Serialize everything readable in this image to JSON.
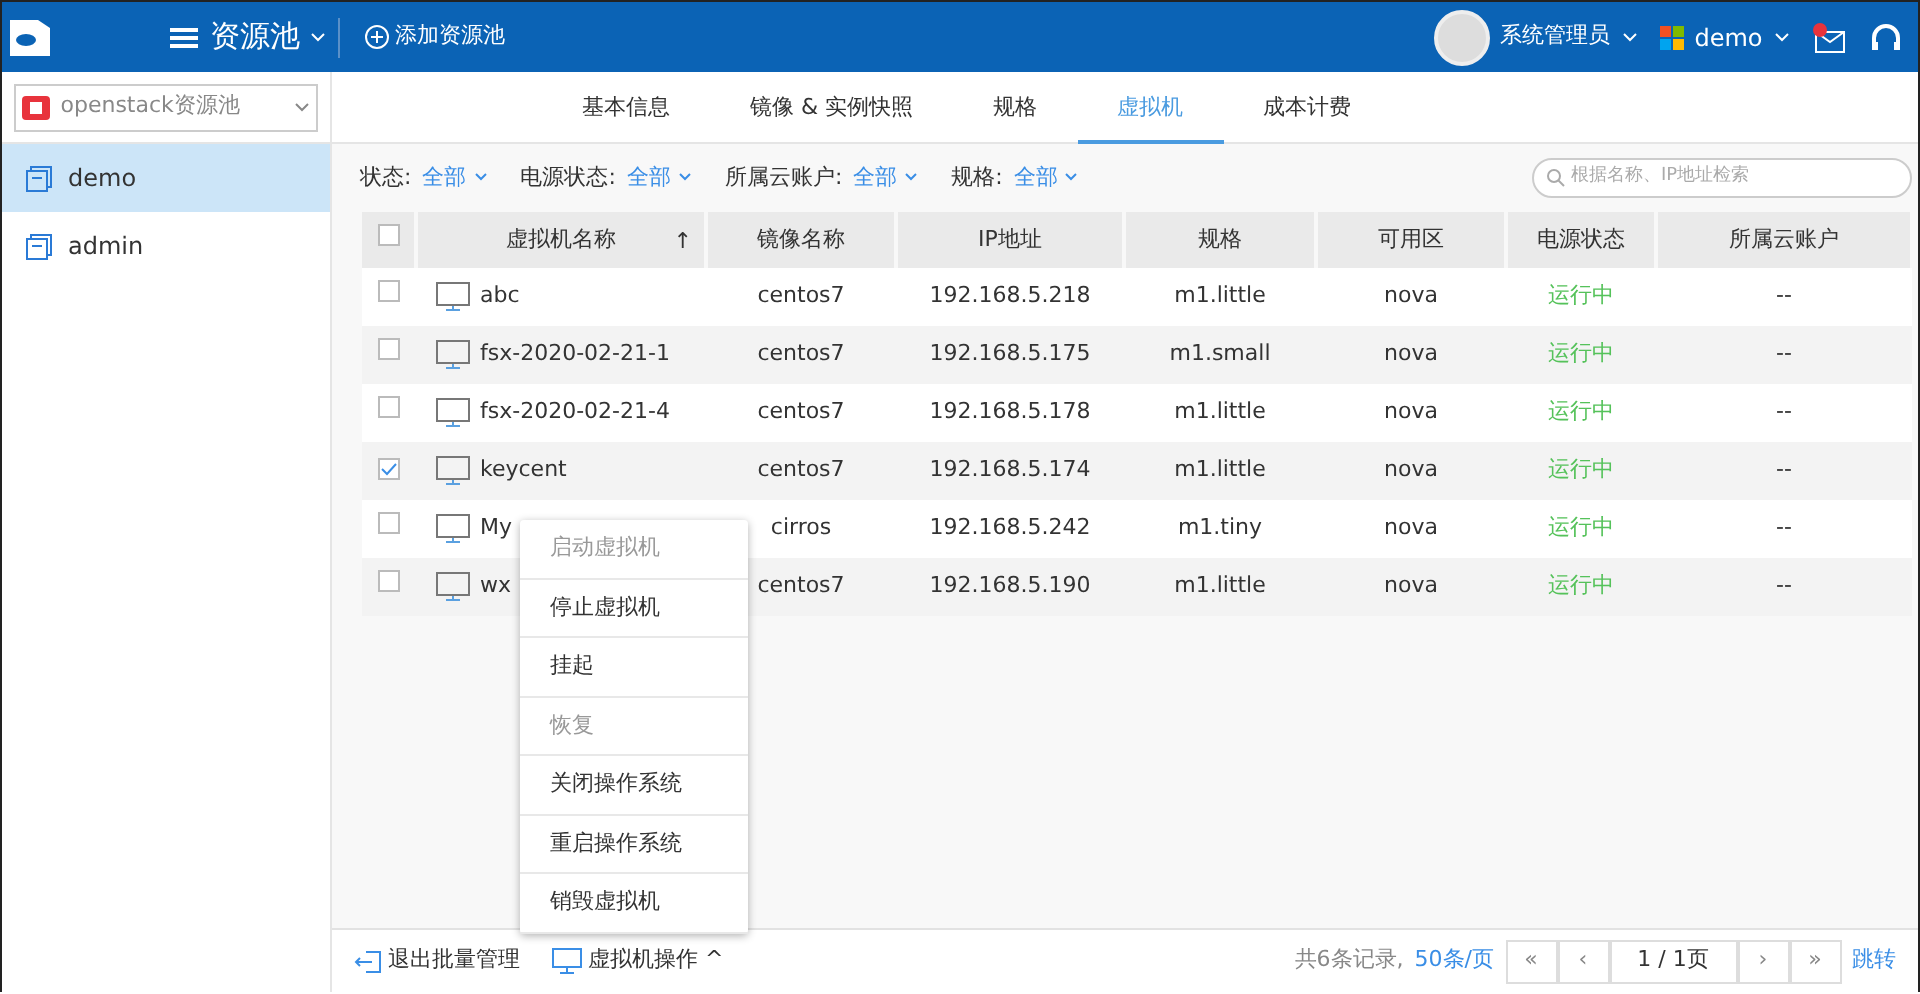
{
  "header": {
    "title": "资源池",
    "add_label": "添加资源池",
    "user": "系统管理员",
    "project": "demo",
    "mail_unread": true
  },
  "pool_select": {
    "value": "openstack资源池"
  },
  "tabs": [
    {
      "label": "基本信息",
      "selected": false
    },
    {
      "label": "镜像 & 实例快照",
      "selected": false
    },
    {
      "label": "规格",
      "selected": false
    },
    {
      "label": "虚拟机",
      "selected": true
    },
    {
      "label": "成本计费",
      "selected": false
    }
  ],
  "sidebar": {
    "items": [
      {
        "label": "demo",
        "selected": true
      },
      {
        "label": "admin",
        "selected": false
      }
    ]
  },
  "filters": [
    {
      "label": "状态:",
      "value": "全部"
    },
    {
      "label": "电源状态:",
      "value": "全部"
    },
    {
      "label": "所属云账户:",
      "value": "全部"
    },
    {
      "label": "规格:",
      "value": "全部"
    }
  ],
  "search": {
    "placeholder": "根据名称、IP地址检索"
  },
  "table": {
    "columns": [
      "虚拟机名称",
      "镜像名称",
      "IP地址",
      "规格",
      "可用区",
      "电源状态",
      "所属云账户"
    ],
    "sort_mark": "↑",
    "select_all_checked": false,
    "rows": [
      {
        "checked": false,
        "cells": [
          "abc",
          "centos7",
          "192.168.5.218",
          "m1.little",
          "nova",
          "运行中",
          "--"
        ]
      },
      {
        "checked": false,
        "cells": [
          "fsx-2020-02-21-1",
          "centos7",
          "192.168.5.175",
          "m1.small",
          "nova",
          "运行中",
          "--"
        ]
      },
      {
        "checked": false,
        "cells": [
          "fsx-2020-02-21-4",
          "centos7",
          "192.168.5.178",
          "m1.little",
          "nova",
          "运行中",
          "--"
        ]
      },
      {
        "checked": true,
        "cells": [
          "keycent",
          "centos7",
          "192.168.5.174",
          "m1.little",
          "nova",
          "运行中",
          "--"
        ]
      },
      {
        "checked": false,
        "cells": [
          "My",
          "cirros",
          "192.168.5.242",
          "m1.tiny",
          "nova",
          "运行中",
          "--"
        ]
      },
      {
        "checked": false,
        "cells": [
          "wx",
          "centos7",
          "192.168.5.190",
          "m1.little",
          "nova",
          "运行中",
          "--"
        ]
      }
    ]
  },
  "context_menu": [
    {
      "label": "启动虚拟机",
      "disabled": true
    },
    {
      "label": "停止虚拟机",
      "disabled": false
    },
    {
      "label": "挂起",
      "disabled": false
    },
    {
      "label": "恢复",
      "disabled": true
    },
    {
      "label": "关闭操作系统",
      "disabled": false
    },
    {
      "label": "重启操作系统",
      "disabled": false
    },
    {
      "label": "销毁虚拟机",
      "disabled": false
    }
  ],
  "footer": {
    "exit_label": "退出批量管理",
    "vm_ops_label": "虚拟机操作",
    "vm_ops_caret": "^",
    "total": "共6条记录,",
    "page_size": "50条/页",
    "pager": [
      "«",
      "‹",
      "1 / 1页",
      "›",
      "»"
    ],
    "jump": "跳转"
  }
}
